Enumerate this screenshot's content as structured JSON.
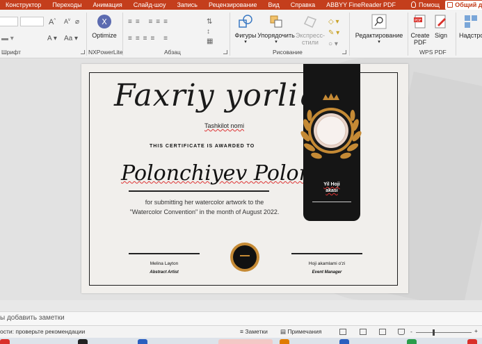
{
  "ribbon_tabs": {
    "tabs": [
      "Конструктор",
      "Переходы",
      "Анимация",
      "Слайд-шоу",
      "Запись",
      "Рецензирование",
      "Вид",
      "Справка",
      "ABBYY FineReader PDF"
    ],
    "help": "Помощ",
    "share": "Общий д"
  },
  "ribbon": {
    "groups": {
      "font": "Шрифт",
      "nxpowerlite": "NXPowerLite",
      "paragraph": "Абзац",
      "drawing": "Рисование",
      "wps_pdf": "WPS PDF"
    },
    "buttons": {
      "optimize": "Optimize",
      "shapes": "Фигуры",
      "arrange": "Упорядочить",
      "quick_styles_1": "Экспресс-",
      "quick_styles_2": "стили",
      "editing": "Редактирование",
      "create_pdf_1": "Create",
      "create_pdf_2": "PDF",
      "sign": "Sign",
      "settings": "Надстро"
    },
    "colors": {
      "tab_bar": "#c43e1c",
      "ribbon_bg": "#f3f3f3"
    }
  },
  "slide": {
    "title": "Faxriy yorliq",
    "organization": "Tashkilot nomi",
    "awarded_to": "THIS CERTIFICATE IS AWARDED TO",
    "recipient": "Polonchiyev Polonchi",
    "description_line1": "for submitting her watercolor artwork to the",
    "description_line2": "\"Watercolor Convention\" in the month of August 2022.",
    "date_line1": "Yil Hoji",
    "date_line2": "akasi",
    "signer_left_name": "Melina Layton",
    "signer_left_role": "Abstract Artist",
    "signer_right_name": "Hoji akamlami o'zi",
    "signer_right_role": "Event Manager",
    "colors": {
      "gold": "#c58a35",
      "banner": "#151515",
      "paper": "#f1efec"
    }
  },
  "notes": {
    "placeholder": "ы добавить заметки"
  },
  "status_bar": {
    "accessibility": "ости: проверьте рекомендации",
    "notes_label": "Заметки",
    "comments_label": "Примечания",
    "zoom_minus": "-",
    "zoom_plus": "+"
  }
}
